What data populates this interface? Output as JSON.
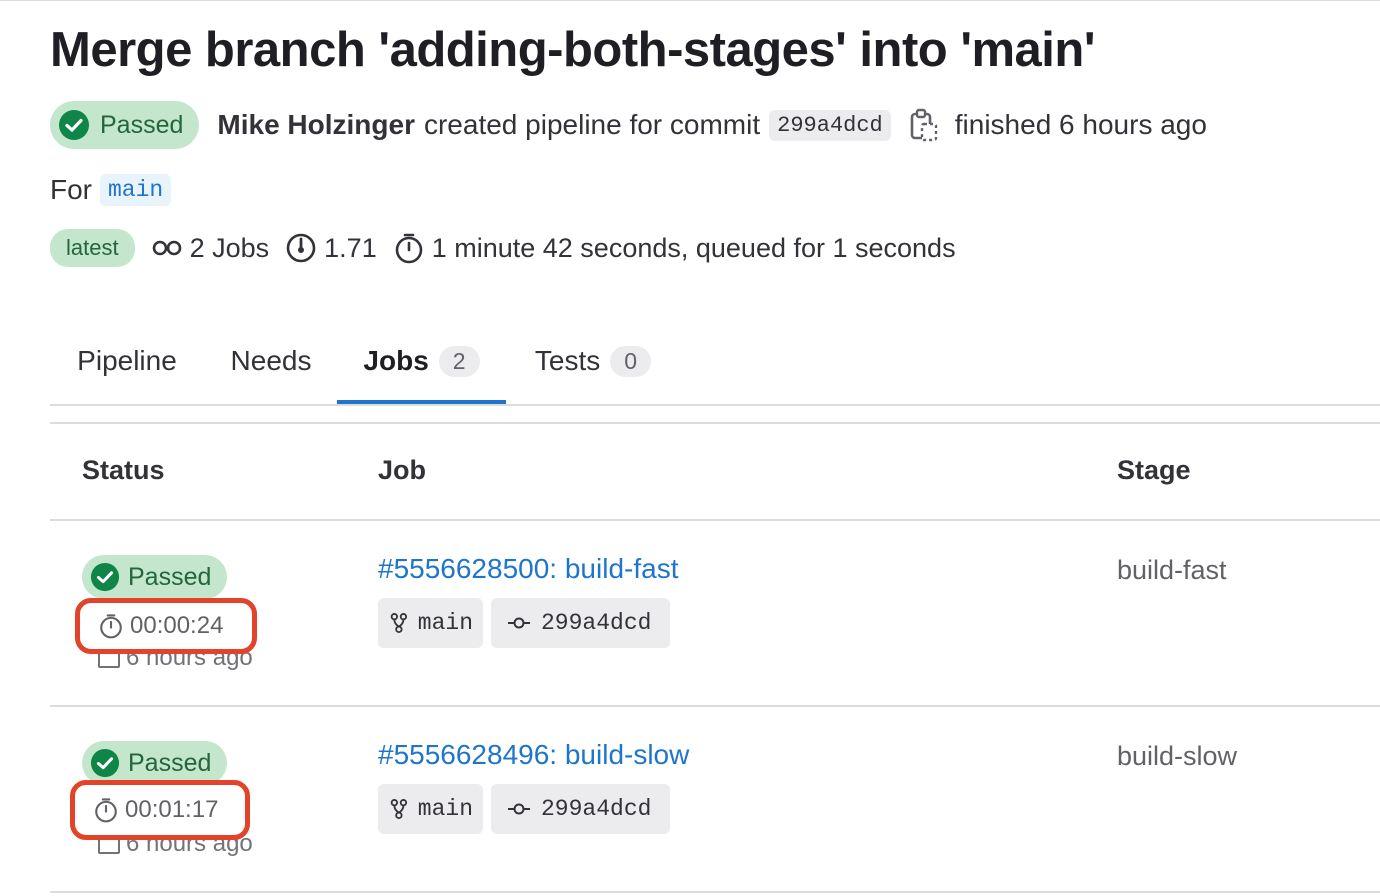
{
  "pipeline": {
    "title": "Merge branch 'adding-both-stages' into 'main'",
    "status_label": "Passed",
    "author": "Mike Holzinger",
    "created_text": "created pipeline for commit",
    "commit_sha": "299a4dcd",
    "finished_text": "finished 6 hours ago",
    "for_label": "For",
    "branch": "main",
    "latest_label": "latest",
    "jobs_count_text": "2 Jobs",
    "compute_minutes": "1.71",
    "duration_text": "1 minute 42 seconds, queued for 1 seconds"
  },
  "tabs": [
    {
      "label": "Pipeline"
    },
    {
      "label": "Needs"
    },
    {
      "label": "Jobs",
      "count": "2"
    },
    {
      "label": "Tests",
      "count": "0"
    }
  ],
  "table": {
    "headers": {
      "status": "Status",
      "job": "Job",
      "stage": "Stage"
    },
    "rows": [
      {
        "status": "Passed",
        "duration": "00:00:24",
        "finished": "6 hours ago",
        "job": "#5556628500: build-fast",
        "branch": "main",
        "commit": "299a4dcd",
        "stage": "build-fast"
      },
      {
        "status": "Passed",
        "duration": "00:01:17",
        "finished": "6 hours ago",
        "job": "#5556628496: build-slow",
        "branch": "main",
        "commit": "299a4dcd",
        "stage": "build-slow"
      }
    ]
  },
  "colors": {
    "success_bg": "#c3e6cd",
    "success_fg": "#24663b",
    "link": "#1f75cb",
    "highlight": "#e24329"
  }
}
